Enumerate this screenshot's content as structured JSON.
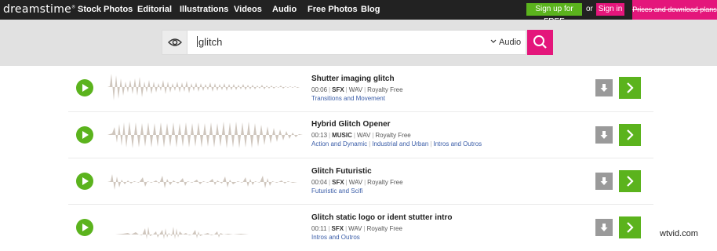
{
  "brand": {
    "logo_text": "dreamstime",
    "logo_mark": "®"
  },
  "nav": {
    "items": [
      {
        "label": "Stock Photos"
      },
      {
        "label": "Editorial"
      },
      {
        "label": "Illustrations"
      },
      {
        "label": "Videos"
      },
      {
        "label": "Audio"
      },
      {
        "label": "Free Photos"
      },
      {
        "label": "Blog"
      }
    ],
    "signup_label": "Sign up for FREE",
    "or_label": "or",
    "signin_label": "Sign in",
    "prices_label": "Prices and download plans"
  },
  "search": {
    "query": "glitch",
    "category": "Audio",
    "icons": {
      "visibility": "eye-icon",
      "submit": "search-icon",
      "dropdown": "chevron-down-icon"
    }
  },
  "colors": {
    "green": "#5bb31d",
    "pink": "#e4167b",
    "topbar": "#222222",
    "wave": "#cfc6bd",
    "link": "#3a5da8"
  },
  "results": [
    {
      "title": "Shutter imaging glitch",
      "duration": "00:06",
      "type": "SFX",
      "format": "WAV",
      "license": "Royalty Free",
      "tags": [
        "Transitions and Movement"
      ]
    },
    {
      "title": "Hybrid Glitch Opener",
      "duration": "00:13",
      "type": "MUSIC",
      "format": "WAV",
      "license": "Royalty Free",
      "tags": [
        "Action and Dynamic",
        "Industrial and Urban",
        "Intros and Outros"
      ]
    },
    {
      "title": "Glitch Futuristic",
      "duration": "00:04",
      "type": "SFX",
      "format": "WAV",
      "license": "Royalty Free",
      "tags": [
        "Futuristic and Scifi"
      ]
    },
    {
      "title": "Glitch static logo or ident stutter intro",
      "duration": "00:11",
      "type": "SFX",
      "format": "WAV",
      "license": "Royalty Free",
      "tags": [
        "Intros and Outros"
      ]
    }
  ],
  "watermark": "wtvid.com"
}
